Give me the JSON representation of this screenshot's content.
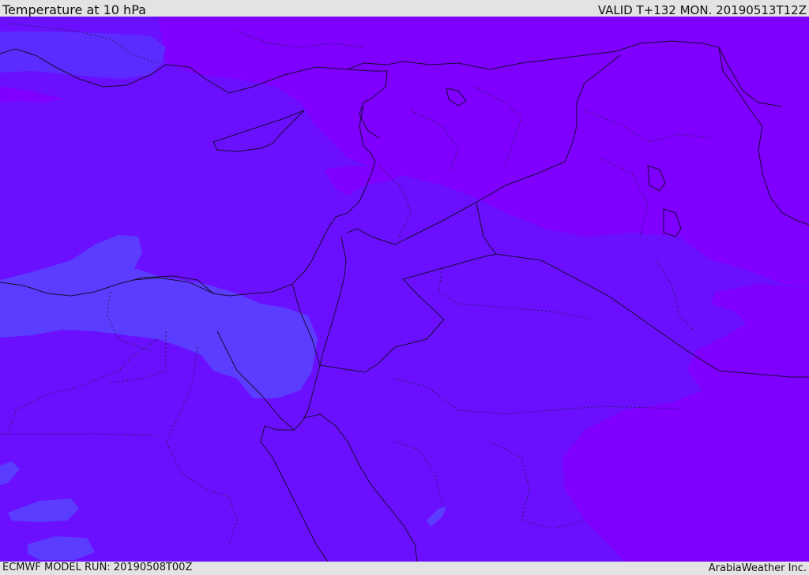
{
  "header": {
    "title": "Temperature at 10 hPa",
    "valid": "VALID T+132 MON. 20190513T12Z"
  },
  "footer": {
    "model_run": "ECMWF MODEL RUN: 20190508T00Z",
    "credit": "ArabiaWeather Inc."
  },
  "map": {
    "field": "temperature",
    "level": "10 hPa",
    "colors": {
      "coldest": "#7f00ff",
      "cold": "#6a10ff",
      "mid": "#5c2bff",
      "light": "#5b3dff",
      "border": "#1a0a33",
      "internal_border": "#2a1a55"
    }
  }
}
